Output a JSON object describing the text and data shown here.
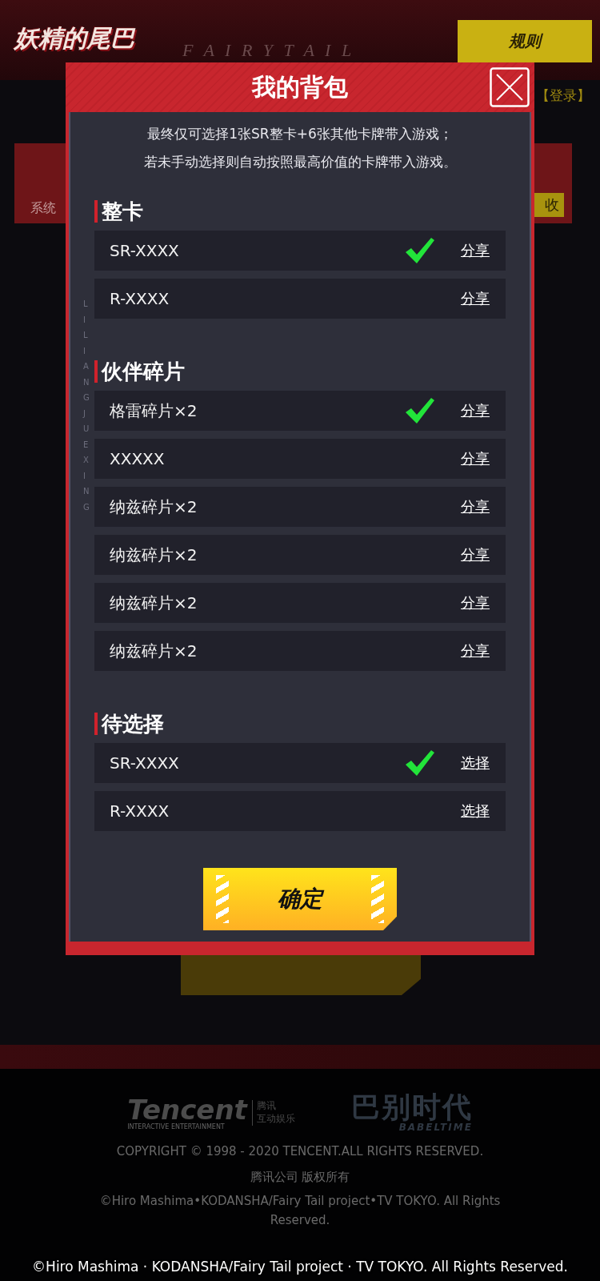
{
  "header": {
    "logo": "妖精的尾巴",
    "brand": "F A I R Y T A I L",
    "rules_button": "规则",
    "login_link": "【登录】"
  },
  "background_card": {
    "label": "系统",
    "button": "收"
  },
  "dialog": {
    "title": "我的背包",
    "notice": [
      "最终仅可选择1张SR整卡+6张其他卡牌带入游戏；",
      "若未手动选择则自动按照最高价值的卡牌带入游戏。"
    ],
    "side_text": "LILIANGJUEXING",
    "sections": [
      {
        "title": "整卡",
        "items": [
          {
            "name": "SR-XXXX",
            "checked": true,
            "action": "分享"
          },
          {
            "name": "R-XXXX",
            "checked": false,
            "action": "分享"
          }
        ]
      },
      {
        "title": "伙伴碎片",
        "items": [
          {
            "name": "格雷碎片×2",
            "checked": true,
            "action": "分享"
          },
          {
            "name": "XXXXX",
            "checked": false,
            "action": "分享"
          },
          {
            "name": "纳兹碎片×2",
            "checked": false,
            "action": "分享"
          },
          {
            "name": "纳兹碎片×2",
            "checked": false,
            "action": "分享"
          },
          {
            "name": "纳兹碎片×2",
            "checked": false,
            "action": "分享"
          },
          {
            "name": "纳兹碎片×2",
            "checked": false,
            "action": "分享"
          }
        ]
      },
      {
        "title": "待选择",
        "items": [
          {
            "name": "SR-XXXX",
            "checked": true,
            "action": "选择"
          },
          {
            "name": "R-XXXX",
            "checked": false,
            "action": "选择"
          }
        ]
      }
    ],
    "confirm_button": "确定"
  },
  "footer": {
    "tencent": {
      "name": "Tencent",
      "tagline": "INTERACTIVE ENTERTAINMENT",
      "cn_top": "腾讯",
      "cn_bottom": "互动娱乐"
    },
    "babeltime": {
      "cn": "巴别时代",
      "en": "BABELTIME"
    },
    "copyright": "COPYRIGHT © 1998 - 2020 TENCENT.ALL RIGHTS RESERVED.",
    "rights_cn": "腾讯公司 版权所有",
    "license": "©Hiro Mashima•KODANSHA/Fairy Tail project•TV TOKYO. All Rights Reserved."
  },
  "caption": "©Hiro Mashima · KODANSHA/Fairy Tail project · TV TOKYO. All Rights Reserved."
}
